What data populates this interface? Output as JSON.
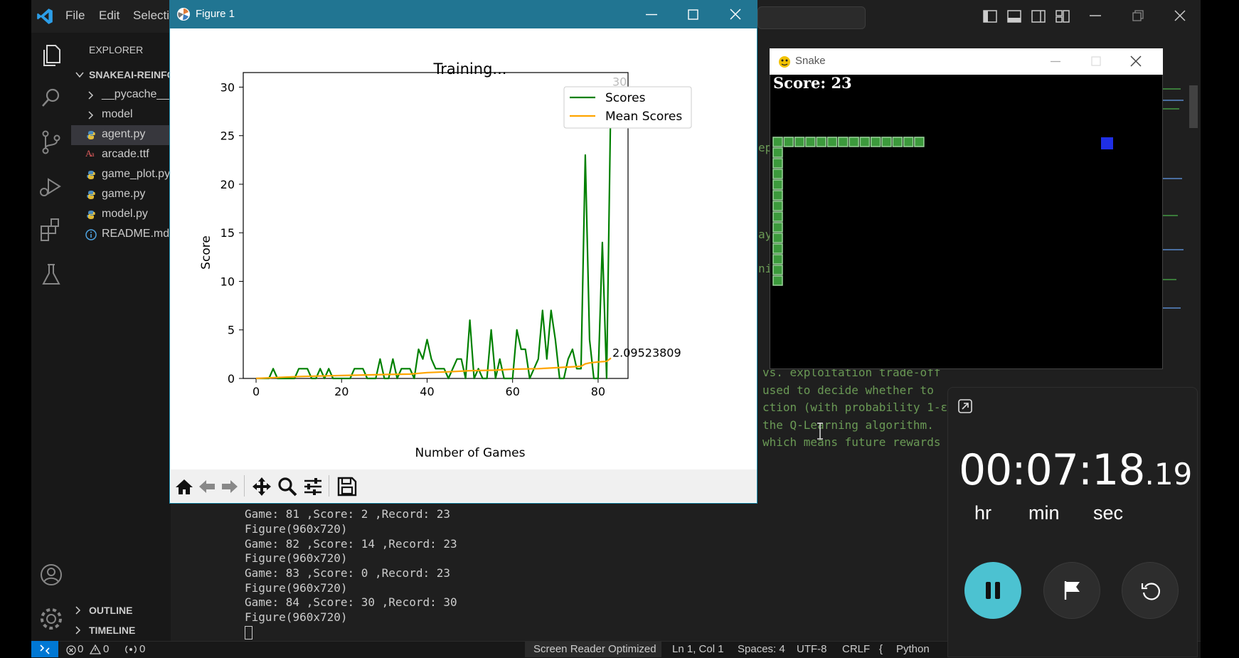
{
  "vscode": {
    "menu": [
      "File",
      "Edit",
      "Selecti"
    ],
    "explorer_title": "EXPLORER",
    "project_name": "SNAKEAI-REINFO",
    "tree": [
      {
        "name": "__pycache__",
        "type": "folder"
      },
      {
        "name": "model",
        "type": "folder"
      },
      {
        "name": "agent.py",
        "type": "python",
        "active": true
      },
      {
        "name": "arcade.ttf",
        "type": "font"
      },
      {
        "name": "game_plot.py",
        "type": "python"
      },
      {
        "name": "game.py",
        "type": "python"
      },
      {
        "name": "model.py",
        "type": "python"
      },
      {
        "name": "README.md",
        "type": "info"
      }
    ],
    "outline_label": "OUTLINE",
    "timeline_label": "TIMELINE",
    "code_fragments": [
      "ep",
      "ay",
      "ni"
    ],
    "code_lines": [
      "vs. exploitation trade-off",
      "used to decide whether to",
      "ction (with probability 1-ε",
      "the Q-Learning algorithm.",
      "which means future rewards"
    ],
    "terminal_lines": [
      "Game: 81 ,Score: 2 ,Record: 23",
      "Figure(960x720)",
      "Game: 82 ,Score: 14 ,Record: 23",
      "Figure(960x720)",
      "Game: 83 ,Score: 0 ,Record: 23",
      "Figure(960x720)",
      "Game: 84 ,Score: 30 ,Record: 30",
      "Figure(960x720)"
    ],
    "status": {
      "errors": "0",
      "warnings": "0",
      "ports": "0",
      "screen_reader": "Screen Reader Optimized",
      "position": "Ln 1, Col 1",
      "spaces": "Spaces: 4",
      "encoding": "UTF-8",
      "eol": "CRLF",
      "language": "Python"
    }
  },
  "figure": {
    "window_title": "Figure 1",
    "toolbar_icons": [
      "home-icon",
      "back-arrow-icon",
      "forward-arrow-icon",
      "pan-icon",
      "zoom-icon",
      "configure-icon",
      "save-icon"
    ]
  },
  "chart_data": {
    "type": "line",
    "title": "Training...",
    "xlabel": "Number of Games",
    "ylabel": "Score",
    "xlim": [
      -3,
      87
    ],
    "ylim": [
      0,
      31.5
    ],
    "xticks": [
      0,
      20,
      40,
      60,
      80
    ],
    "yticks": [
      0,
      5,
      10,
      15,
      20,
      25,
      30
    ],
    "legend_position": "top-right",
    "series": [
      {
        "name": "Scores",
        "color": "#008000",
        "x": [
          0,
          1,
          2,
          3,
          4,
          5,
          6,
          7,
          8,
          9,
          10,
          11,
          12,
          13,
          14,
          15,
          16,
          17,
          18,
          19,
          20,
          21,
          22,
          23,
          24,
          25,
          26,
          27,
          28,
          29,
          30,
          31,
          32,
          33,
          34,
          35,
          36,
          37,
          38,
          39,
          40,
          41,
          42,
          43,
          44,
          45,
          46,
          47,
          48,
          49,
          50,
          51,
          52,
          53,
          54,
          55,
          56,
          57,
          58,
          59,
          60,
          61,
          62,
          63,
          64,
          65,
          66,
          67,
          68,
          69,
          70,
          71,
          72,
          73,
          74,
          75,
          76,
          77,
          78,
          79,
          80,
          81,
          82,
          83
        ],
        "values": [
          0,
          0,
          0,
          0,
          1,
          0,
          0,
          0,
          0,
          0,
          1,
          1,
          1,
          0,
          0,
          1,
          0,
          1,
          0,
          0,
          0,
          0,
          0,
          1,
          1,
          1,
          0,
          0,
          0,
          2,
          0,
          0,
          2,
          0,
          1,
          1,
          1,
          0,
          3,
          2,
          4,
          2,
          1,
          1,
          1,
          0,
          1,
          2,
          2,
          0,
          6,
          0,
          1,
          0,
          0,
          5,
          0,
          2,
          0,
          0,
          0,
          5,
          3,
          3,
          0,
          1,
          2,
          7,
          2,
          7,
          4,
          0,
          0,
          2,
          3,
          1,
          1,
          23,
          4,
          0,
          0,
          14,
          0,
          30
        ]
      },
      {
        "name": "Mean Scores",
        "color": "#ffa500",
        "x": [
          0,
          10,
          20,
          30,
          36,
          40,
          46,
          50,
          56,
          60,
          66,
          70,
          74,
          76,
          77,
          78,
          80,
          82,
          83
        ],
        "values": [
          0,
          0.2,
          0.3,
          0.4,
          0.45,
          0.6,
          0.7,
          0.8,
          0.85,
          0.95,
          1.0,
          1.1,
          1.2,
          1.25,
          1.5,
          1.6,
          1.7,
          1.76,
          2.095
        ]
      }
    ],
    "annotations": [
      {
        "text": "30",
        "x": 83,
        "y": 30
      },
      {
        "text": "2.09523809",
        "x": 83,
        "y": 2.095
      }
    ]
  },
  "snake": {
    "window_title": "Snake",
    "score_text": "Score: 23",
    "snake_color": "#3c9a3c",
    "food_color": "#1f2fe6"
  },
  "clock": {
    "time_main": "00:07:18",
    "time_frac": ".19",
    "unit_hr": "hr",
    "unit_min": "min",
    "unit_sec": "sec",
    "accent": "#4cc2d1"
  }
}
